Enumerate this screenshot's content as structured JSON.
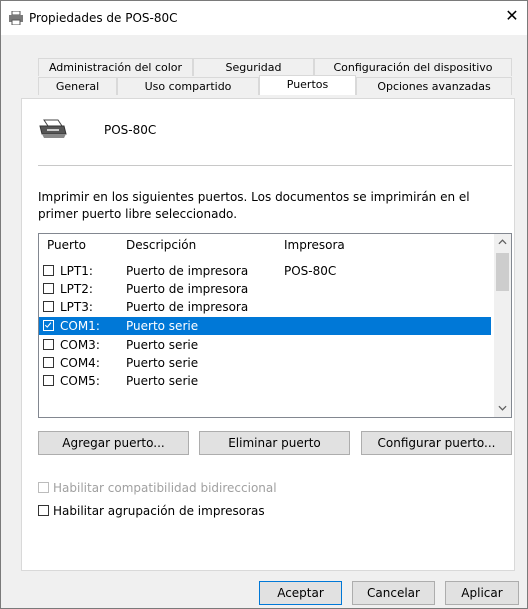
{
  "window": {
    "title": "Propiedades de POS-80C",
    "close_glyph": "✕"
  },
  "tabs_back": [
    {
      "label": "Administración del color"
    },
    {
      "label": "Seguridad"
    },
    {
      "label": "Configuración del dispositivo"
    }
  ],
  "tabs_front": [
    {
      "label": "General"
    },
    {
      "label": "Uso compartido"
    },
    {
      "label": "Puertos",
      "active": true
    },
    {
      "label": "Opciones avanzadas"
    }
  ],
  "printer": {
    "name": "POS-80C",
    "icon": "printer-icon"
  },
  "description": "Imprimir en los siguientes puertos. Los documentos se imprimirán en el primer puerto libre seleccionado.",
  "port_list": {
    "headers": {
      "port": "Puerto",
      "description": "Descripción",
      "printer": "Impresora"
    },
    "rows": [
      {
        "checked": false,
        "port": "LPT1:",
        "description": "Puerto de impresora",
        "printer": "POS-80C",
        "selected": false
      },
      {
        "checked": false,
        "port": "LPT2:",
        "description": "Puerto de impresora",
        "printer": "",
        "selected": false
      },
      {
        "checked": false,
        "port": "LPT3:",
        "description": "Puerto de impresora",
        "printer": "",
        "selected": false
      },
      {
        "checked": true,
        "port": "COM1:",
        "description": "Puerto serie",
        "printer": "",
        "selected": true
      },
      {
        "checked": false,
        "port": "COM3:",
        "description": "Puerto serie",
        "printer": "",
        "selected": false
      },
      {
        "checked": false,
        "port": "COM4:",
        "description": "Puerto serie",
        "printer": "",
        "selected": false
      },
      {
        "checked": false,
        "port": "COM5:",
        "description": "Puerto serie",
        "printer": "",
        "selected": false
      }
    ]
  },
  "buttons": {
    "add_port": "Agregar puerto...",
    "delete_port": "Eliminar puerto",
    "configure_port": "Configurar puerto..."
  },
  "options": {
    "bidirectional": {
      "label": "Habilitar compatibilidad bidireccional",
      "checked": false,
      "enabled": false
    },
    "pooling": {
      "label": "Habilitar agrupación de impresoras",
      "checked": false,
      "enabled": true
    }
  },
  "footer": {
    "ok": "Aceptar",
    "cancel": "Cancelar",
    "apply": "Aplicar"
  },
  "colors": {
    "selection": "#0078d7",
    "panel": "#ffffff",
    "dialog": "#f0f0f0"
  }
}
